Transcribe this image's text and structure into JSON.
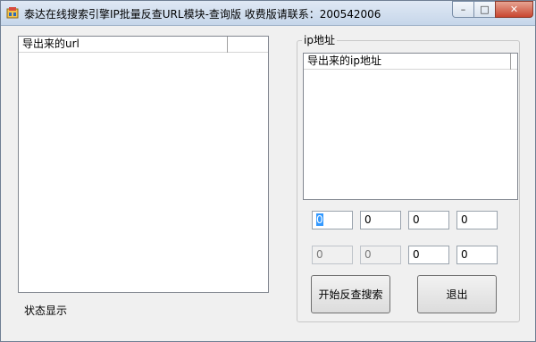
{
  "window": {
    "title": "泰达在线搜索引擎IP批量反查URL模块-查询版 收费版请联系：200542006",
    "controls": {
      "minimize": "–",
      "maximize": "□",
      "close": "✕"
    }
  },
  "url_list": {
    "column_header": "导出来的url"
  },
  "ip_group": {
    "label": "ip地址",
    "list_header": "导出来的ip地址",
    "start_ip": [
      "0",
      "0",
      "0",
      "0"
    ],
    "end_ip": [
      "0",
      "0",
      "0",
      "0"
    ]
  },
  "buttons": {
    "start": "开始反查搜索",
    "exit": "退出"
  },
  "status": "状态显示"
}
